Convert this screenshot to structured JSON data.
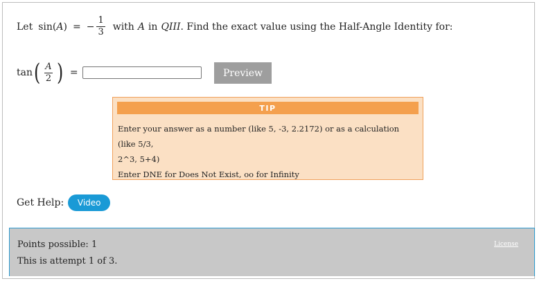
{
  "question": {
    "prefix": "Let",
    "sin_func": "sin",
    "var_a": "A",
    "equals": "=",
    "minus": "−",
    "frac_num": "1",
    "frac_den": "3",
    "with_text": "with",
    "in_text": "in",
    "quadrant": "QIII",
    "suffix": ". Find the exact value using the Half-Angle Identity for:"
  },
  "answer": {
    "tan_func": "tan",
    "frac_num": "A",
    "frac_den": "2",
    "equals": "=",
    "input_value": "",
    "preview_label": "Preview"
  },
  "tip": {
    "header": "TIP",
    "line1": "Enter your answer as a number (like 5, -3, 2.2172) or as a calculation (like 5/3,",
    "line2": "2^3, 5+4)",
    "line3": "Enter DNE for Does Not Exist, oo for Infinity"
  },
  "help": {
    "label": "Get Help:",
    "video_label": "Video"
  },
  "footer": {
    "points": "Points possible: 1",
    "attempt": "This is attempt 1 of 3.",
    "license": "License"
  },
  "colors": {
    "preview_button": "#9e9e9e",
    "tip_header": "#f4a04e",
    "tip_background": "#fbe0c4",
    "video_button": "#1a9ad6",
    "footer_background": "#c8c8c8"
  }
}
